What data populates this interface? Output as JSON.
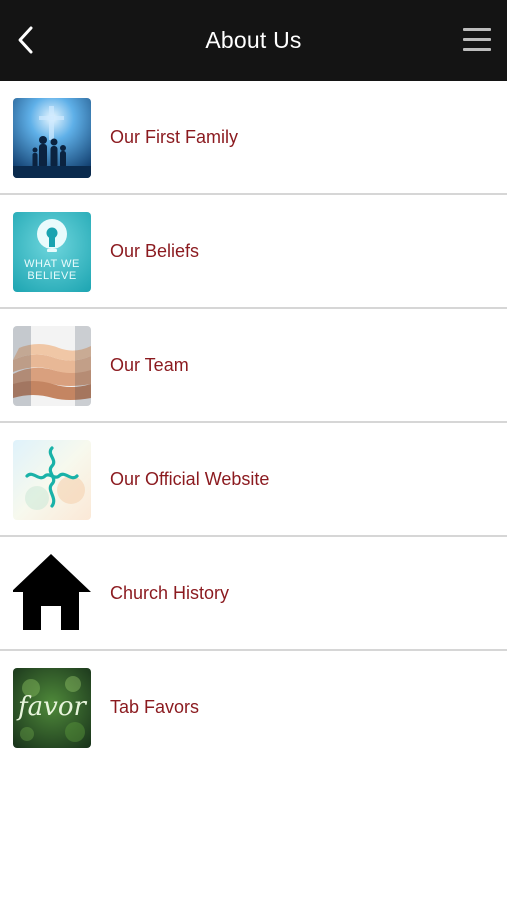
{
  "header": {
    "title": "About Us",
    "back_icon": "chevron-left-icon",
    "menu_icon": "hamburger-menu-icon",
    "background": "#141414"
  },
  "items": [
    {
      "label": "Our First Family",
      "icon": "family-photo-thumbnail"
    },
    {
      "label": "Our Beliefs",
      "icon": "lightbulb-what-we-believe-thumbnail",
      "thumb_text": "WHAT WE BELIEVE"
    },
    {
      "label": "Our Team",
      "icon": "stacked-hands-thumbnail"
    },
    {
      "label": "Our Official Website",
      "icon": "cross-logo-thumbnail"
    },
    {
      "label": "Church History",
      "icon": "house-icon"
    },
    {
      "label": "Tab Favors",
      "icon": "favor-thumbnail",
      "thumb_text": "favor"
    }
  ],
  "colors": {
    "label": "#8b1a1f",
    "divider": "#d6d6d6"
  }
}
